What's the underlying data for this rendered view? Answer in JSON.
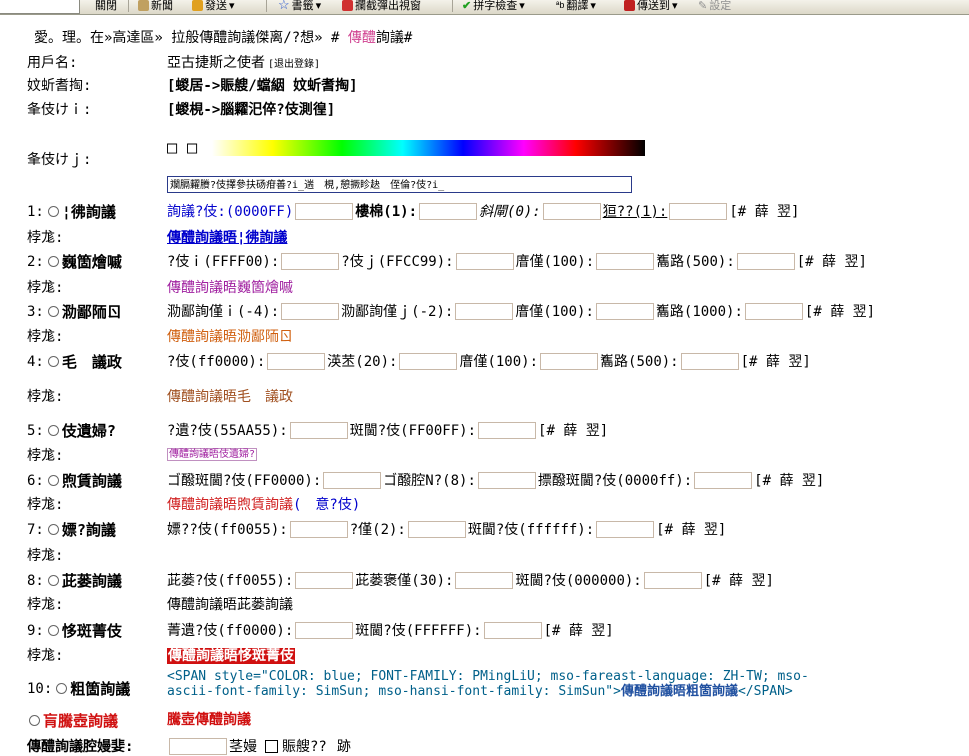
{
  "toolbar": {
    "items": [
      {
        "label": "關閉",
        "icon": "close-doc-icon",
        "color": "#8a8a8a"
      },
      {
        "label": "新聞",
        "icon": "news-icon",
        "color": "#c0a060"
      },
      {
        "label": "發送",
        "icon": "send-icon",
        "color": "#e0a020"
      },
      {
        "label": "書籤",
        "icon": "star-icon",
        "color": "#2050d0"
      },
      {
        "label": "攔截彈出視窗",
        "icon": "popup-block-icon",
        "color": "#d03030"
      },
      {
        "label": "拼字檢查",
        "icon": "check-icon",
        "color": "#20a020"
      },
      {
        "label": "翻譯",
        "icon": "translate-icon",
        "color": "#606060"
      },
      {
        "label": "傳送到",
        "icon": "send-to-icon",
        "color": "#c02020"
      },
      {
        "label": "設定",
        "icon": "wrench-icon",
        "color": "#909090"
      }
    ]
  },
  "breadcrumb": {
    "a": "愛。理。在»高達區» 拉般傳醴詢議傑离/?想» # ",
    "b": "傳醴",
    "c": "詢議#"
  },
  "user": {
    "label": "用戶名:",
    "name": "亞古捷斯之使者",
    "logout": "[退出登錄]"
  },
  "field2": {
    "label": "妏蚚耆掏:",
    "value": "[蝬居->賑艘/蟷絪 妏蚚耆掏]"
  },
  "field3": {
    "label": "夆伎けｉ:",
    "value": "[蝬梘->腦糶汜倅?伎測徨]"
  },
  "field4": {
    "label": "夆伎けｊ:",
    "boxes": [
      "□",
      "□"
    ]
  },
  "preview_input": {
    "value": "斕膈糶賸?伎擇參扶砀疳善?i_遄　梘,憩撅眕赽　侄倫?伎?i_"
  },
  "items": [
    {
      "num": "1:",
      "name": "¦彿詢議",
      "nameColor": "#000000",
      "fields": [
        {
          "t": "詢議?伎:(0000FF)",
          "c": "#0000cc"
        },
        {
          "t": "樓棉(1):",
          "c": "#000000",
          "b": true
        },
        {
          "t": "斜閘(0):",
          "c": "#000000",
          "i": true
        },
        {
          "t": "狟??(1):",
          "c": "#000000",
          "u": true
        }
      ],
      "apply": "[# 薛 翌]",
      "preview": "傳醴詢議晤¦彿詢議",
      "pColor": "#0000cc"
    },
    {
      "num": "2:",
      "name": "巍箇燴嘁",
      "nameColor": "#000000",
      "fields": [
        {
          "t": "?伎ｉ(FFFF00):",
          "c": "#000000"
        },
        {
          "t": "?伎ｊ(FFCC99):",
          "c": "#000000"
        },
        {
          "t": "庴僅(100):",
          "c": "#000000"
        },
        {
          "t": "雟路(500):",
          "c": "#000000"
        }
      ],
      "apply": "[# 薛 翌]",
      "preview": "傳醴詢議晤巍箇燴嘁",
      "pColor": "#a020a0"
    },
    {
      "num": "3:",
      "name": "泐鄙陑ㄖ",
      "nameColor": "#000000",
      "fields": [
        {
          "t": "泐鄙詢僅ｉ(-4):",
          "c": "#000000"
        },
        {
          "t": "泐鄙詢僅ｊ(-2):",
          "c": "#000000"
        },
        {
          "t": "庴僅(100):",
          "c": "#000000"
        },
        {
          "t": "雟路(1000):",
          "c": "#000000"
        }
      ],
      "apply": "[# 薛 翌]",
      "preview": "傳醴詢議晤泐鄙陑ㄖ",
      "pColor": "#d06010"
    },
    {
      "num": "4:",
      "name": "毛　議政",
      "nameColor": "#000000",
      "fields": [
        {
          "t": "?伎(ff0000):",
          "c": "#000000"
        },
        {
          "t": "渶苤(20):",
          "c": "#000000"
        },
        {
          "t": "庴僅(100):",
          "c": "#000000"
        },
        {
          "t": "雟路(500):",
          "c": "#000000"
        }
      ],
      "apply": "[# 薛 翌]",
      "preview": "傳醴詢議晤毛　議政",
      "pColor": "#a05020"
    },
    {
      "num": "5:",
      "name": "伎遺婦?",
      "nameColor": "#000000",
      "fields": [
        {
          "t": "?遺?伎(55AA55):",
          "c": "#000000"
        },
        {
          "t": "斑閫?伎(FF00FF):",
          "c": "#000000"
        }
      ],
      "apply": "[# 薛 翌]",
      "preview": "傳醴詢議晤伎遺婦?",
      "pColor": "#a020a0"
    },
    {
      "num": "6:",
      "name": "煦賃詢議",
      "nameColor": "#000000",
      "fields": [
        {
          "t": "ゴ醱斑閫?伎(FF0000):",
          "c": "#000000"
        },
        {
          "t": "ゴ醱腔N?(8):",
          "c": "#000000"
        },
        {
          "t": "摽醱斑閫?伎(0000ff):",
          "c": "#000000"
        }
      ],
      "apply": "[# 薛 翌]",
      "preview": "傳醴詢議晤煦賃詢議",
      "pColor": "#d02020",
      "preview2": "(　意?伎)",
      "p2Color": "#0000cc"
    },
    {
      "num": "7:",
      "name": "嫖?詢議",
      "nameColor": "#000000",
      "fields": [
        {
          "t": "嫖??伎(ff0055):",
          "c": "#000000"
        },
        {
          "t": "?僅(2):",
          "c": "#000000"
        },
        {
          "t": "斑閫?伎(ffffff):",
          "c": "#000000"
        }
      ],
      "apply": "[# 薛 翌]",
      "preview": "",
      "pColor": "#000000"
    },
    {
      "num": "8:",
      "name": "茈蒌詢議",
      "nameColor": "#000000",
      "fields": [
        {
          "t": "茈蒌?伎(ff0055):",
          "c": "#000000"
        },
        {
          "t": "茈蒌褒僅(30):",
          "c": "#000000"
        },
        {
          "t": "斑閫?伎(000000):",
          "c": "#000000"
        }
      ],
      "apply": "[# 薛 翌]",
      "preview": "傳醴詢議晤茈蒌詢議",
      "pColor": "#000000"
    },
    {
      "num": "9:",
      "name": "恀斑菁伎",
      "nameColor": "#000000",
      "fields": [
        {
          "t": "菁遺?伎(ff0000):",
          "c": "#000000"
        },
        {
          "t": "斑閫?伎(FFFFFF):",
          "c": "#000000"
        }
      ],
      "apply": "[# 薛 翌]",
      "preview": "傳醴詢議晤恀斑菁伎",
      "pColor": "#ffffff"
    }
  ],
  "preview_label": "桲尨:",
  "item10": {
    "num": "10:",
    "name": "粗箇詢議",
    "code_line1": "<SPAN style=\"COLOR: blue; FONT-FAMILY: PMingLiU; mso-fareast-language: ZH-TW; mso-",
    "code_line2": "ascii-font-family: SimSun; mso-hansi-font-family: SimSun\">",
    "code_tail": "傳醴詢議晤粗箇詢議",
    "code_end": "</SPAN>"
  },
  "random": {
    "name": "肓騰壺詢議",
    "value": "騰壺傳醴詢議"
  },
  "bottom": {
    "label": "傳醴詢議腔嫚婓:",
    "mid": "茎嫚",
    "chk": "賑艘??",
    "end": "跡"
  }
}
